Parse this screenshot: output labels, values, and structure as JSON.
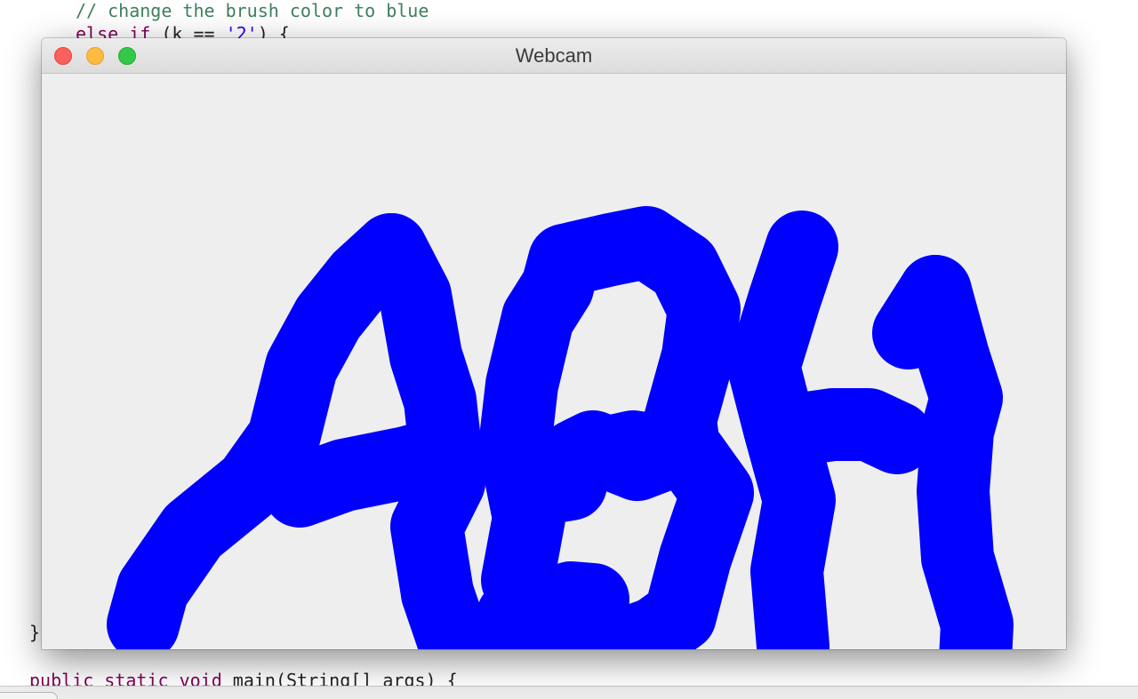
{
  "editor": {
    "lines": [
      {
        "id": "comment",
        "parts": [
          {
            "cls": "c-comment",
            "text": "// change the brush color to blue"
          }
        ]
      },
      {
        "id": "else-if",
        "parts": [
          {
            "cls": "c-kw",
            "text": "else if"
          },
          {
            "cls": "c-plain",
            "text": " (k == "
          },
          {
            "cls": "c-str",
            "text": "'2'"
          },
          {
            "cls": "c-plain",
            "text": ") {"
          }
        ]
      },
      {
        "id": "close-brace",
        "parts": [
          {
            "cls": "c-plain",
            "text": "}"
          }
        ]
      },
      {
        "id": "main-sig",
        "parts": [
          {
            "cls": "c-kw",
            "text": "public static void"
          },
          {
            "cls": "c-plain",
            "text": " main(String[] args) {"
          }
        ]
      }
    ]
  },
  "window": {
    "title": "Webcam",
    "canvas_background": "#eeeeee",
    "brush_color": "#0000ff",
    "drawn_text": "ABH"
  }
}
